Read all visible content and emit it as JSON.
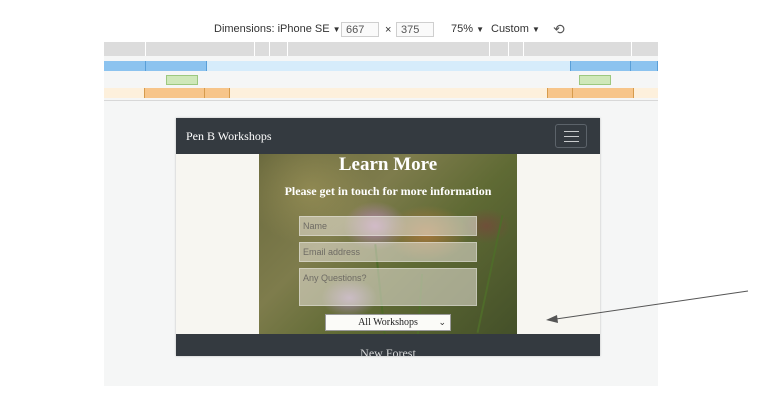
{
  "devtools": {
    "dimensions_label": "Dimensions: iPhone SE",
    "width_value": "667",
    "height_value": "375",
    "times_symbol": "×",
    "zoom_label": "75%",
    "throttle_label": "Custom",
    "dropdown_arrow": "▼",
    "rotate_icon": "⟲"
  },
  "page": {
    "brand": "Pen B Workshops",
    "hero_title": "Learn More",
    "hero_subtitle": "Please get in touch for more information",
    "form": {
      "name_placeholder": "Name",
      "email_placeholder": "Email address",
      "questions_placeholder": "Any Questions?",
      "select_value": "All Workshops"
    },
    "footer_text": "New Forest"
  },
  "colors": {
    "navbar": "#343a40",
    "page_background": "#f7f6f1",
    "annotation_arrow": "#555555"
  }
}
